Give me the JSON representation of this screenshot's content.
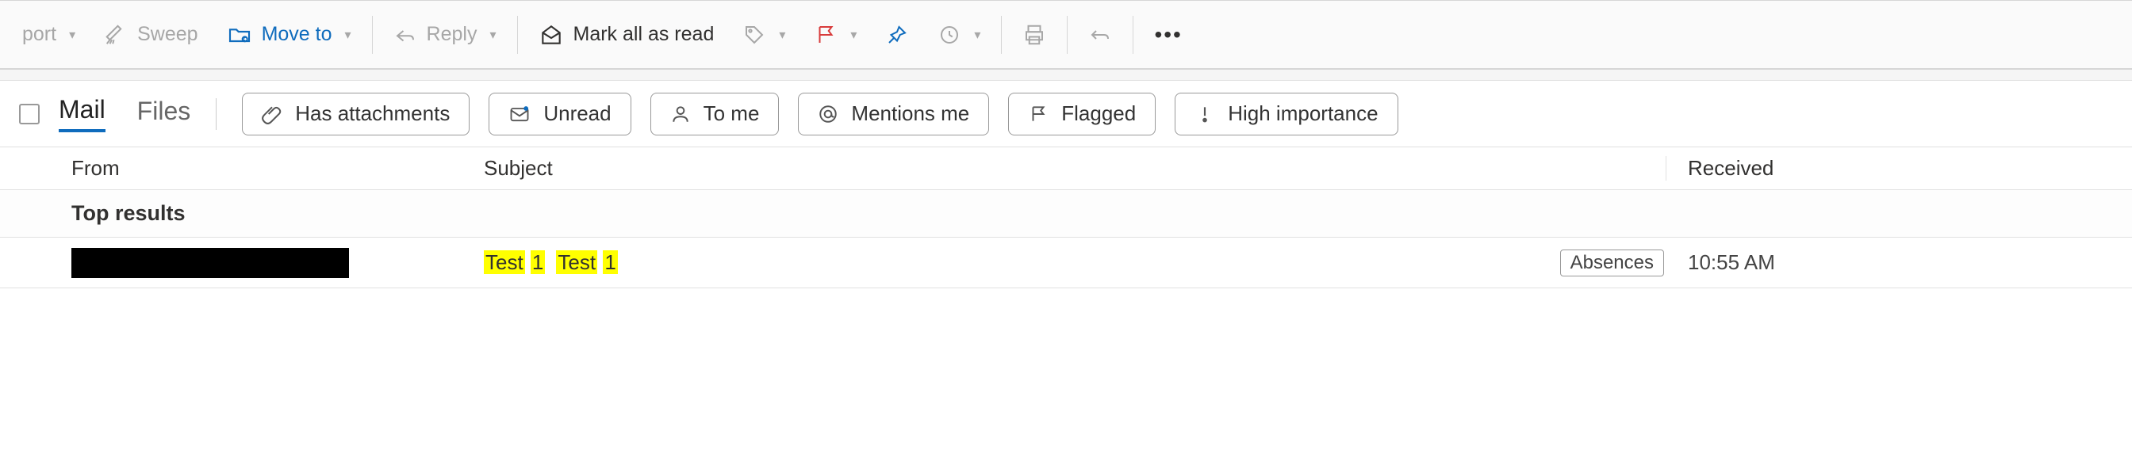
{
  "toolbar": {
    "report_label": "port",
    "sweep_label": "Sweep",
    "move_to_label": "Move to",
    "reply_label": "Reply",
    "mark_all_read_label": "Mark all as read"
  },
  "tabs": {
    "mail": "Mail",
    "files": "Files"
  },
  "filters": {
    "has_attachments": "Has attachments",
    "unread": "Unread",
    "to_me": "To me",
    "mentions_me": "Mentions me",
    "flagged": "Flagged",
    "high_importance": "High importance"
  },
  "columns": {
    "from": "From",
    "subject": "Subject",
    "received": "Received"
  },
  "section_top_results": "Top results",
  "rows": [
    {
      "subject_parts": [
        "Test",
        "1",
        "Test",
        "1"
      ],
      "category": "Absences",
      "received": "10:55 AM"
    }
  ]
}
